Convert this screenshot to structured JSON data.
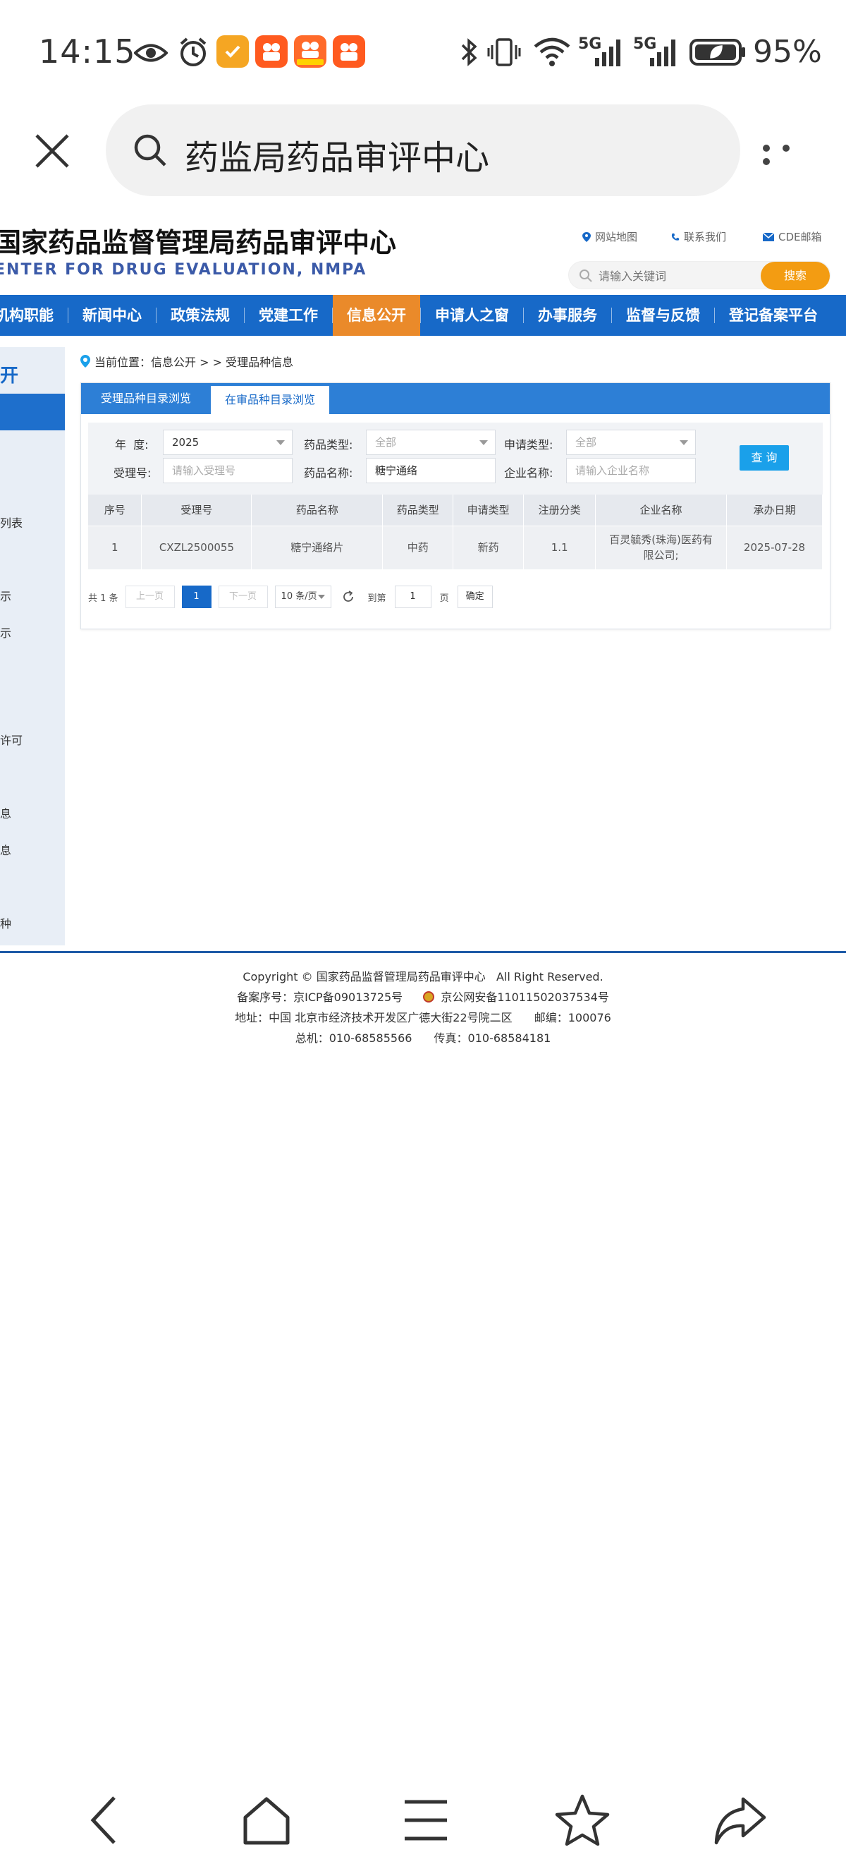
{
  "status_bar": {
    "time": "14:15",
    "network_1": "5G",
    "network_2": "5G",
    "battery": "95%",
    "icons": [
      "eye-icon",
      "alarm-icon",
      "app-heart-icon",
      "app-video-icon",
      "app-video-festival-icon",
      "app-video-icon",
      "bluetooth-icon",
      "vibrate-icon",
      "wifi-icon",
      "signal-icon",
      "signal-icon",
      "battery-icon"
    ]
  },
  "browser": {
    "query": "药监局药品审评中心"
  },
  "site": {
    "title": "国家药品监督管理局药品审评中心",
    "subtitle": "ENTER FOR DRUG EVALUATION, NMPA",
    "links": [
      "网站地图",
      "联系我们",
      "CDE邮箱"
    ],
    "search_placeholder": "请输入关键词",
    "search_button": "搜索"
  },
  "nav": {
    "items": [
      "机构职能",
      "新闻中心",
      "政策法规",
      "党建工作",
      "信息公开",
      "申请人之窗",
      "办事服务",
      "监督与反馈",
      "登记备案平台"
    ],
    "active_index": 4
  },
  "sidebar": {
    "title": "开",
    "links": [
      "列表",
      "示",
      "示",
      "许可",
      "息",
      "息",
      "种"
    ]
  },
  "breadcrumb": {
    "text": "当前位置：信息公开 > > 受理品种信息"
  },
  "tabs": [
    "受理品种目录浏览",
    "在审品种目录浏览"
  ],
  "filters": {
    "year_label": "年  度:",
    "year_value": "2025",
    "drug_type_label": "药品类型:",
    "drug_type_value": "全部",
    "apply_type_label": "申请类型:",
    "apply_type_value": "全部",
    "accept_no_label": "受理号:",
    "accept_no_placeholder": "请输入受理号",
    "drug_name_label": "药品名称:",
    "drug_name_value": "糖宁通络",
    "company_label": "企业名称:",
    "company_placeholder": "请输入企业名称",
    "query_button": "查 询"
  },
  "table": {
    "headers": [
      "序号",
      "受理号",
      "药品名称",
      "药品类型",
      "申请类型",
      "注册分类",
      "企业名称",
      "承办日期"
    ],
    "rows": [
      [
        "1",
        "CXZL2500055",
        "糖宁通络片",
        "中药",
        "新药",
        "1.1",
        "百灵毓秀(珠海)医药有限公司;",
        "2025-07-28"
      ]
    ]
  },
  "pager": {
    "total": "共 1 条",
    "prev": "上一页",
    "current": "1",
    "next": "下一页",
    "page_size": "10 条/页",
    "goto_label": "到第",
    "goto_value": "1",
    "page_unit": "页",
    "confirm": "确定"
  },
  "footer": {
    "copyright": "Copyright © 国家药品监督管理局药品审评中心   All Right Reserved.",
    "icp": "备案序号：京ICP备09013725号",
    "police": "京公网安备11011502037534号",
    "address": "地址：中国 北京市经济技术开发区广德大街22号院二区",
    "postcode": "邮编：100076",
    "phone": "总机：010-68585566",
    "fax": "传真：010-68584181"
  },
  "colors": {
    "nav_blue": "#1769c8",
    "nav_active": "#ea8a2a",
    "search_button": "#f39c12",
    "query_button": "#1aa0ea"
  }
}
